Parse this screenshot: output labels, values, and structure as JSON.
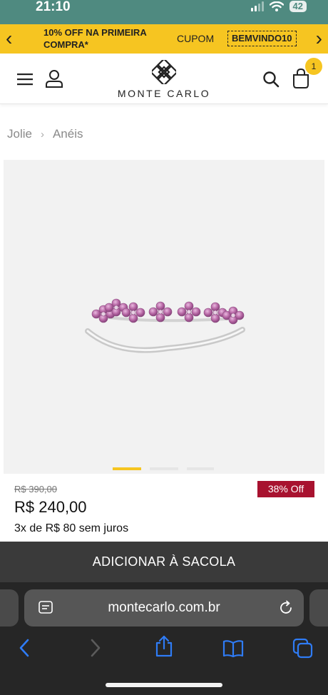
{
  "status_bar": {
    "time": "21:10",
    "battery": "42"
  },
  "promo": {
    "text": "10% OFF NA PRIMEIRA COMPRA*",
    "coupon_label": "CUPOM",
    "coupon_code": "BEMVINDO10"
  },
  "header": {
    "logo_text": "MONTE CARLO",
    "cart_count": "1"
  },
  "breadcrumb": [
    "Jolie",
    "Anéis"
  ],
  "carousel": {
    "slides": 3,
    "active": 0
  },
  "product": {
    "old_price": "R$ 390,00",
    "discount": "38% Off",
    "price": "R$ 240,00",
    "installments": "3x de R$ 80 sem juros"
  },
  "add_to_bag_label": "ADICIONAR À SACOLA",
  "browser": {
    "url": "montecarlo.com.br"
  },
  "colors": {
    "accent": "#f6c521",
    "discount": "#a8122f",
    "gem": "#a65d96",
    "safari_blue": "#2f7cf6"
  }
}
